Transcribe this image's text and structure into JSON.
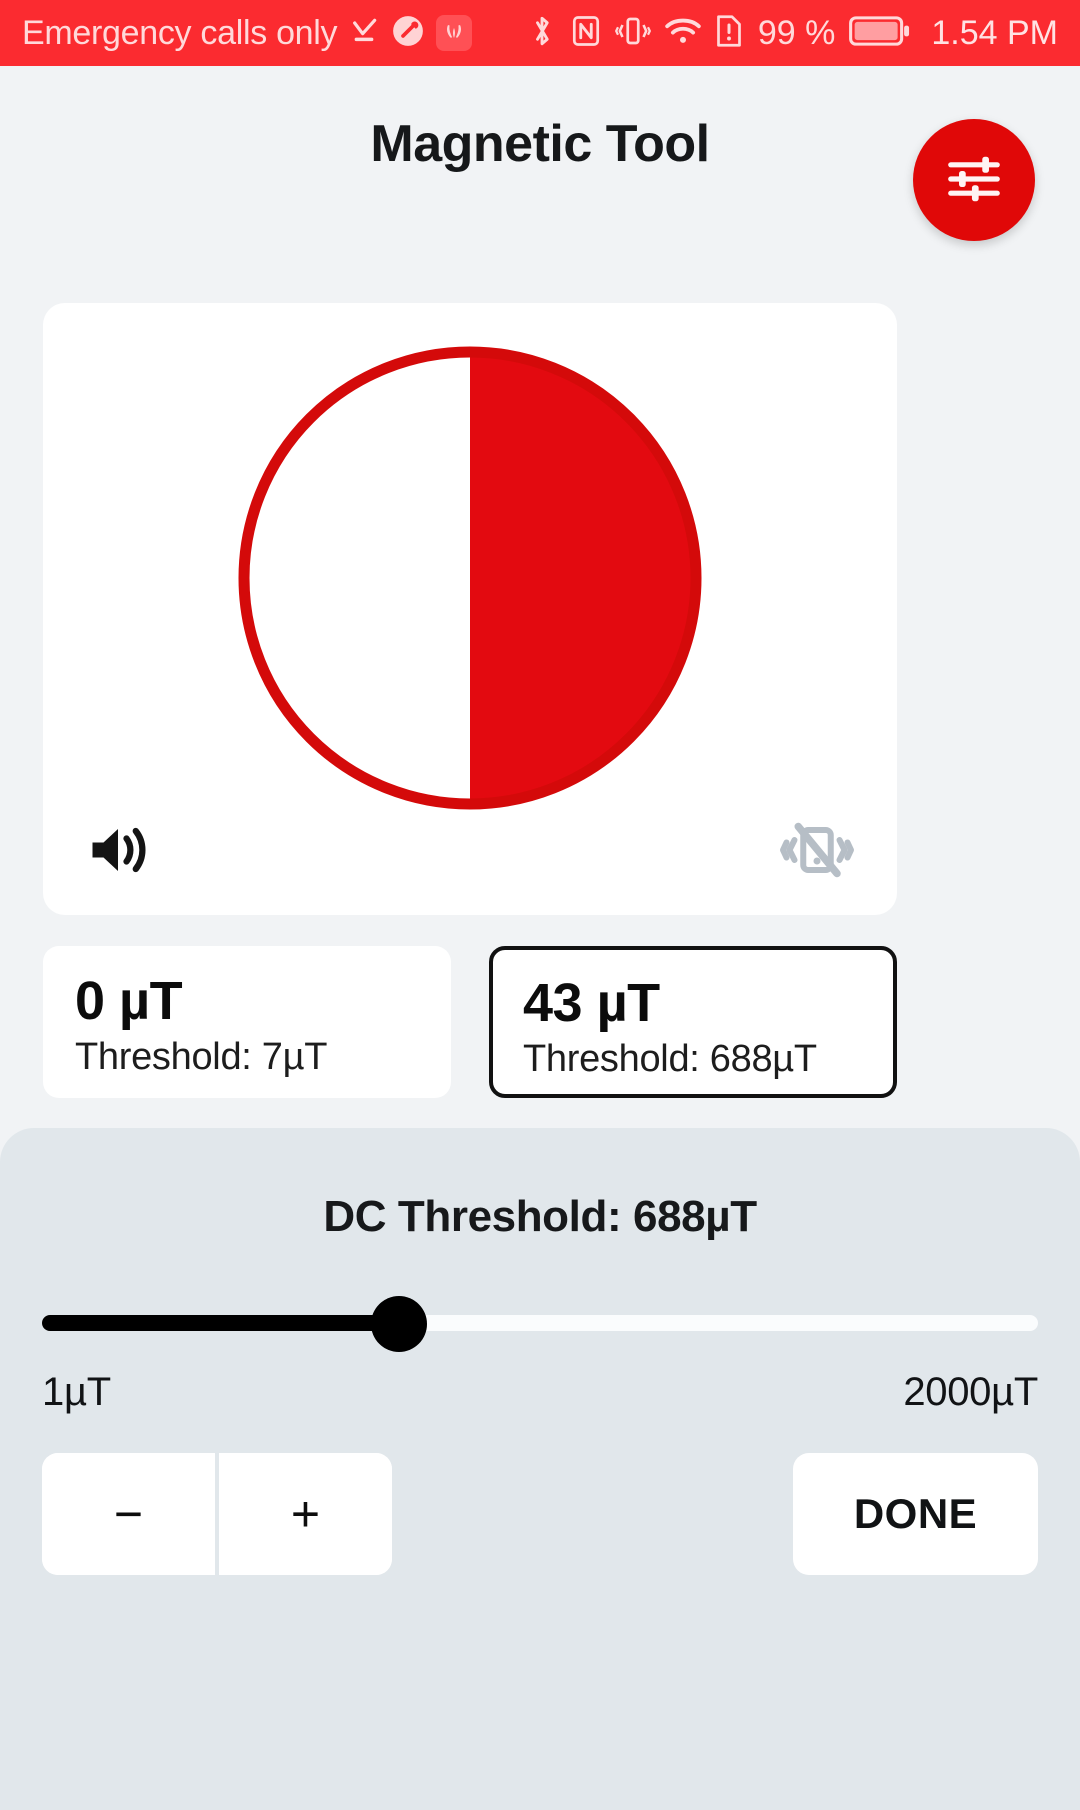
{
  "status_bar": {
    "carrier_text": "Emergency calls only",
    "battery_percent": "99 %",
    "time": "1.54 PM",
    "background_color": "#FB2B30",
    "icons": [
      "download-complete-icon",
      "do-not-disturb-icon",
      "huawei-logo-icon",
      "bluetooth-icon",
      "nfc-icon",
      "vibrate-icon",
      "wifi-icon",
      "sim-alert-icon",
      "battery-icon"
    ]
  },
  "header": {
    "title": "Magnetic Tool",
    "settings_button_icon": "tuner-sliders-icon",
    "accent_color": "#E00808"
  },
  "gauge": {
    "fill_percent": 50,
    "ring_color": "#D40A0A",
    "fill_color": "#E30A10",
    "sound_icon": "speaker-on-icon",
    "vibrate_icon": "vibrate-off-icon",
    "sound_enabled": true,
    "vibrate_enabled": false
  },
  "readings": [
    {
      "name": "ac-reading",
      "value": "0 µT",
      "threshold": "Threshold: 7µT",
      "selected": false
    },
    {
      "name": "dc-reading",
      "value": "43 µT",
      "threshold": "Threshold: 688µT",
      "selected": true
    }
  ],
  "threshold_panel": {
    "title": "DC Threshold: 688µT",
    "slider": {
      "min_label": "1µT",
      "max_label": "2000µT",
      "min": 1,
      "max": 2000,
      "value": 688,
      "fill_percent": 35.8
    },
    "decrement_label": "−",
    "increment_label": "+",
    "done_label": "DONE"
  }
}
